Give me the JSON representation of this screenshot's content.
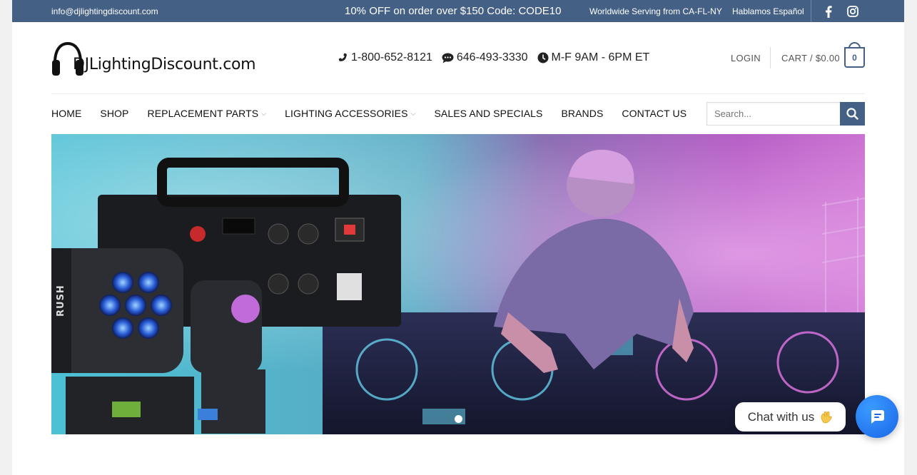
{
  "topbar": {
    "email": "info@djlightingdiscount.com",
    "promo": "10% OFF on order over $150  Code: CODE10",
    "worldwide": "Worldwide Serving from CA-FL-NY",
    "spanish": "Hablamos Español",
    "social": [
      "facebook-icon",
      "instagram-icon"
    ]
  },
  "header": {
    "logo_text": "DJLightingDiscount.com",
    "phone": "1-800-652-8121",
    "sms": "646-493-3330",
    "hours": "M-F 9AM - 6PM ET",
    "login": "LOGIN",
    "cart_label": "CART / $0.00",
    "cart_count": "0"
  },
  "nav": {
    "items": [
      {
        "label": "HOME",
        "dropdown": false
      },
      {
        "label": "SHOP",
        "dropdown": false
      },
      {
        "label": "REPLACEMENT PARTS",
        "dropdown": true
      },
      {
        "label": "LIGHTING ACCESSORIES",
        "dropdown": true
      },
      {
        "label": "SALES AND SPECIALS",
        "dropdown": false
      },
      {
        "label": "BRANDS",
        "dropdown": false
      },
      {
        "label": "CONTACT US",
        "dropdown": false
      }
    ]
  },
  "search": {
    "placeholder": "Search..."
  },
  "hero": {
    "slides": 1,
    "active_slide": 1,
    "fixture_label": "RUSH"
  },
  "chat": {
    "label": "Chat with us"
  },
  "colors": {
    "brand": "#446084",
    "chat": "#1a73e8"
  }
}
